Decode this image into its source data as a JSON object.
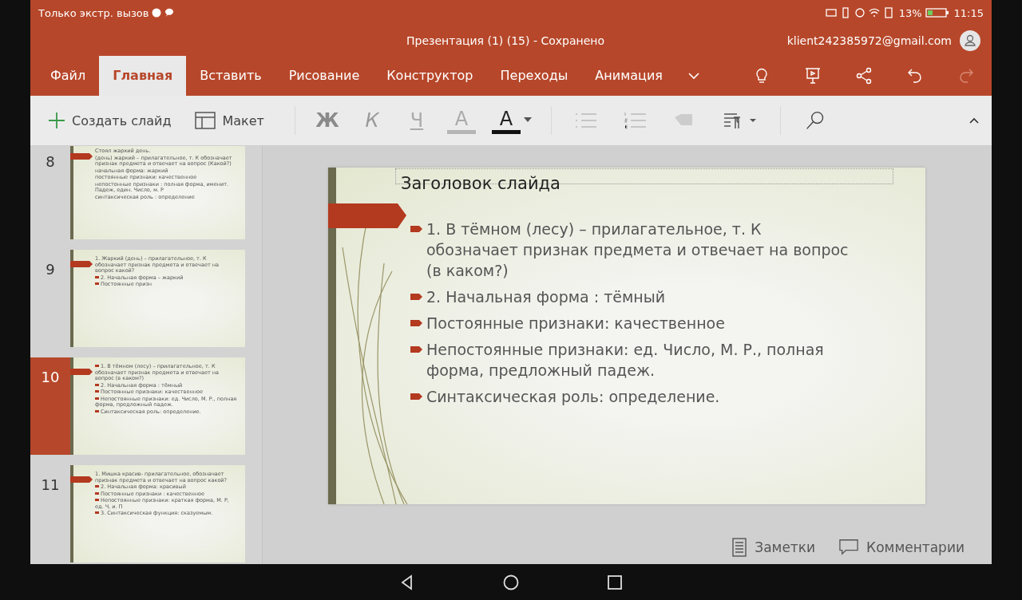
{
  "status_bar": {
    "carrier": "Только экстр. вызов",
    "battery": "13%",
    "time": "11:15"
  },
  "window": {
    "title": "Презентация (1) (15) - Сохранено",
    "account": "klient242385972@gmail.com"
  },
  "tabs": [
    {
      "label": "Файл",
      "selected": false
    },
    {
      "label": "Главная",
      "selected": true
    },
    {
      "label": "Вставить",
      "selected": false
    },
    {
      "label": "Рисование",
      "selected": false
    },
    {
      "label": "Конструктор",
      "selected": false
    },
    {
      "label": "Переходы",
      "selected": false
    },
    {
      "label": "Анимация",
      "selected": false
    }
  ],
  "ribbon": {
    "new_slide": "Создать слайд",
    "layout": "Макет",
    "format_buttons": [
      {
        "kind": "bold",
        "label": "Ж"
      },
      {
        "kind": "italic",
        "label": "К"
      },
      {
        "kind": "underline",
        "label": "Ч"
      },
      {
        "kind": "highlight",
        "label": "А"
      },
      {
        "kind": "fontcolor",
        "label": "А"
      }
    ]
  },
  "thumbnails": [
    {
      "number": "8",
      "selected": false,
      "lines": [
        {
          "text": "Стоял жаркий день.",
          "bullet": false
        },
        {
          "text": "(день) жаркий – прилагательное, т. К обозначает признак предмета и отвечает на вопрос (Какой?)",
          "bullet": false
        },
        {
          "text": "начальная форма: жаркий",
          "bullet": false
        },
        {
          "text": "постоянные признаки: качественное",
          "bullet": false
        },
        {
          "text": "непостонные признаки : полная форма, именит. Падеж, един. Число, м. Р",
          "bullet": false
        },
        {
          "text": "синтаксическая роль : определение",
          "bullet": false
        }
      ]
    },
    {
      "number": "9",
      "selected": false,
      "lines": [
        {
          "text": "1. Жаркий (день) – прилагательное, т. К обозначает признак предмета и отвечает на вопрос какой?",
          "bullet": false
        },
        {
          "text": "2. Начальная форма – жаркий",
          "bullet": true
        },
        {
          "text": "Постоянные призн",
          "bullet": true
        }
      ]
    },
    {
      "number": "10",
      "selected": true,
      "lines": [
        {
          "text": "1. В тёмном (лесу) – прилагательное, т. К обозначает признак предмета и отвечает на вопрос (в каком?)",
          "bullet": true
        },
        {
          "text": "2. Начальная форма : тёмный",
          "bullet": true
        },
        {
          "text": "Постоянные признаки: качественное",
          "bullet": true
        },
        {
          "text": "Непостоянные признаки: ед. Число, М. Р., полная форма, предложный падеж.",
          "bullet": true
        },
        {
          "text": "Синтаксическая роль: определение.",
          "bullet": true
        }
      ]
    },
    {
      "number": "11",
      "selected": false,
      "lines": [
        {
          "text": "1. Мишка красив- прилагательное, обозначает признак предмета и отвечает на вопрос какой?",
          "bullet": false
        },
        {
          "text": "2. Начальная форма: красивый",
          "bullet": true
        },
        {
          "text": "Постоянные признаки : качественное",
          "bullet": true
        },
        {
          "text": "Непостоянные признаки: краткая форма, М. Р, ед. Ч, и. П",
          "bullet": true
        },
        {
          "text": "3. Синтаксическая функция: сказуемым.",
          "bullet": true
        }
      ]
    }
  ],
  "slide": {
    "title": "Заголовок слайда",
    "bullets": [
      "1. В тёмном (лесу) – прилагательное, т. К обозначает признак предмета и отвечает на вопрос (в каком?)",
      "2. Начальная форма : тёмный",
      "Постоянные признаки: качественное",
      "Непостоянные признаки: ед. Число, М. Р., полная форма, предложный падеж.",
      "Синтаксическая роль: определение."
    ]
  },
  "footer": {
    "notes": "Заметки",
    "comments": "Комментарии"
  }
}
